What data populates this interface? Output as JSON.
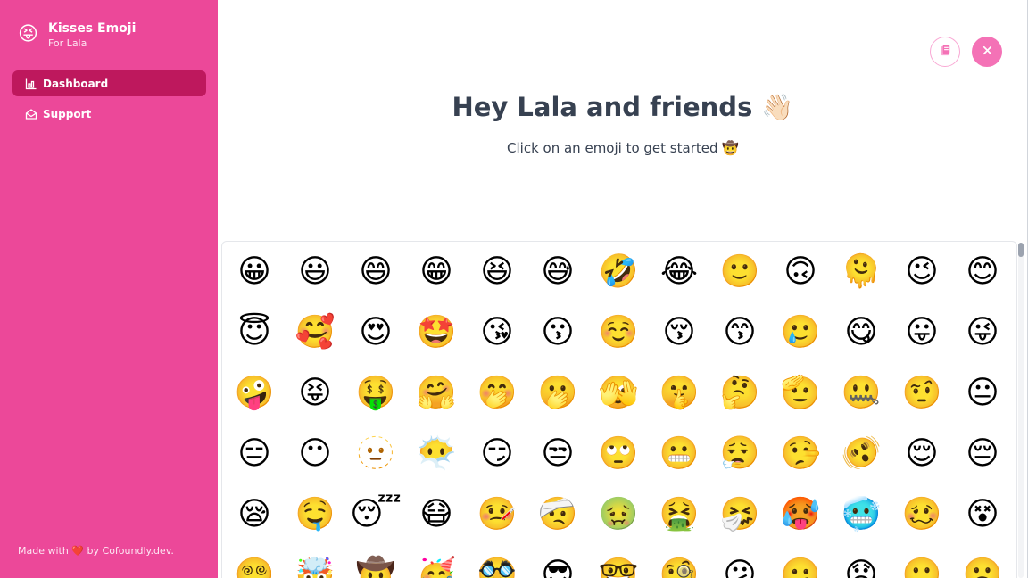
{
  "sidebar": {
    "brand_logo": "😝",
    "brand_title": "Kisses Emoji",
    "brand_subtitle": "For Lala",
    "nav": [
      {
        "label": "Dashboard",
        "icon": "chart-icon",
        "active": true
      },
      {
        "label": "Support",
        "icon": "inbox-icon",
        "active": false
      }
    ],
    "footer": {
      "prefix": "Made with",
      "heart": "❤️",
      "suffix": "by Cofoundly.dev."
    }
  },
  "toolbar": {
    "copy_icon": "clipboard-icon",
    "close_icon": "close-icon"
  },
  "hero": {
    "title": "Hey Lala and friends 👋🏻",
    "subtitle": "Click on an emoji to get started 🤠"
  },
  "emojis": [
    "😀",
    "😃",
    "😄",
    "😁",
    "😆",
    "😅",
    "🤣",
    "😂",
    "🙂",
    "🙃",
    "🫠",
    "😉",
    "😊",
    "😇",
    "🥰",
    "😍",
    "🤩",
    "😘",
    "😗",
    "☺️",
    "😚",
    "😙",
    "🥲",
    "😋",
    "😛",
    "😜",
    "🤪",
    "😝",
    "🤑",
    "🤗",
    "🤭",
    "🫢",
    "🫣",
    "🤫",
    "🤔",
    "🫡",
    "🤐",
    "🤨",
    "😐",
    "😑",
    "😶",
    "🫥",
    "😶‍🌫️",
    "😏",
    "😒",
    "🙄",
    "😬",
    "😮‍💨",
    "🤥",
    "🫨",
    "😌",
    "😔",
    "😪",
    "🤤",
    "😴",
    "😷",
    "🤒",
    "🤕",
    "🤢",
    "🤮",
    "🤧",
    "🥵",
    "🥶",
    "🥴",
    "😵",
    "😵‍💫",
    "🤯",
    "🤠",
    "🥳",
    "🥸",
    "😎",
    "🤓",
    "🧐",
    "😕",
    "🫤",
    "😟",
    "🙁",
    "☹️"
  ],
  "colors": {
    "sidebar": "#ec4899",
    "active_nav": "#be185d",
    "close_button": "#f472b6",
    "text": "#374151"
  }
}
